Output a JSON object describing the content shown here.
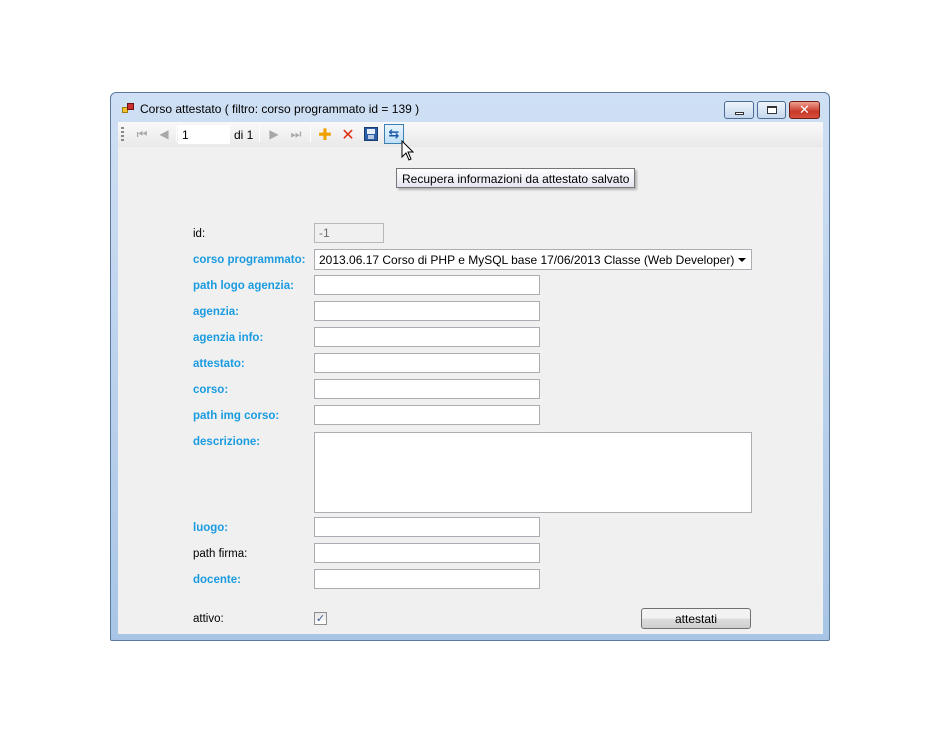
{
  "window": {
    "title": "Corso attestato ( filtro: corso programmato id = 139 )"
  },
  "navigator": {
    "position": "1",
    "count_label": "di 1",
    "tooltip": "Recupera informazioni da attestato salvato"
  },
  "form": {
    "id": {
      "label": "id:",
      "value": "-1"
    },
    "corso_programmato": {
      "label": "corso programmato:",
      "value": "2013.06.17 Corso di PHP e MySQL base 17/06/2013 Classe (Web Developer)"
    },
    "path_logo_agenzia": {
      "label": "path logo agenzia:",
      "value": ""
    },
    "agenzia": {
      "label": "agenzia:",
      "value": ""
    },
    "agenzia_info": {
      "label": "agenzia info:",
      "value": ""
    },
    "attestato": {
      "label": "attestato:",
      "value": ""
    },
    "corso": {
      "label": "corso:",
      "value": ""
    },
    "path_img_corso": {
      "label": "path img corso:",
      "value": ""
    },
    "descrizione": {
      "label": "descrizione:",
      "value": ""
    },
    "luogo": {
      "label": "luogo:",
      "value": ""
    },
    "path_firma": {
      "label": "path firma:",
      "value": ""
    },
    "docente": {
      "label": "docente:",
      "value": ""
    },
    "attivo": {
      "label": "attivo:",
      "checked": true
    },
    "attestati_button": "attestati"
  },
  "colors": {
    "required_label": "#1a9be0",
    "window_border": "#5b7aa0"
  }
}
